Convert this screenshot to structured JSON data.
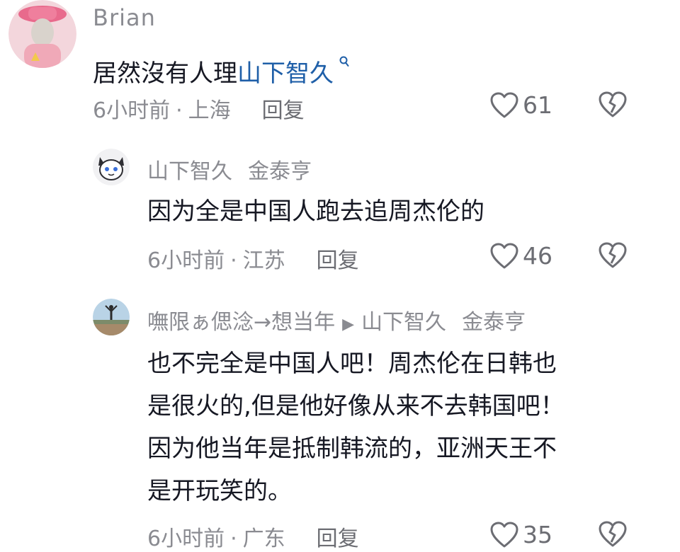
{
  "comments": [
    {
      "username": "Brian",
      "text_prefix": "居然沒有人理",
      "mention": "山下智久",
      "mention_icon": "search-icon",
      "time": "6小时前",
      "location": "上海",
      "reply_label": "回复",
      "likes": "61"
    },
    {
      "username": "山下智久",
      "tag": "金泰亨",
      "text": "因为全是中国人跑去追周杰伦的",
      "time": "6小时前",
      "location": "江苏",
      "reply_label": "回复",
      "likes": "46"
    },
    {
      "username": "嘸限ぁ偲淰→想当年",
      "reply_to": "山下智久",
      "tag": "金泰亨",
      "text_lines": [
        "也不完全是中国人吧！周杰伦在日韩也",
        "是很火的,但是他好像从来不去韩国吧！",
        "因为他当年是抵制韩流的，亚洲天王不",
        "是开玩笑的。"
      ],
      "time": "6小时前",
      "location": "广东",
      "reply_label": "回复",
      "likes": "35"
    }
  ],
  "colors": {
    "meta": "#8a8b91",
    "mention": "#1f5fa8",
    "text": "#161823"
  }
}
